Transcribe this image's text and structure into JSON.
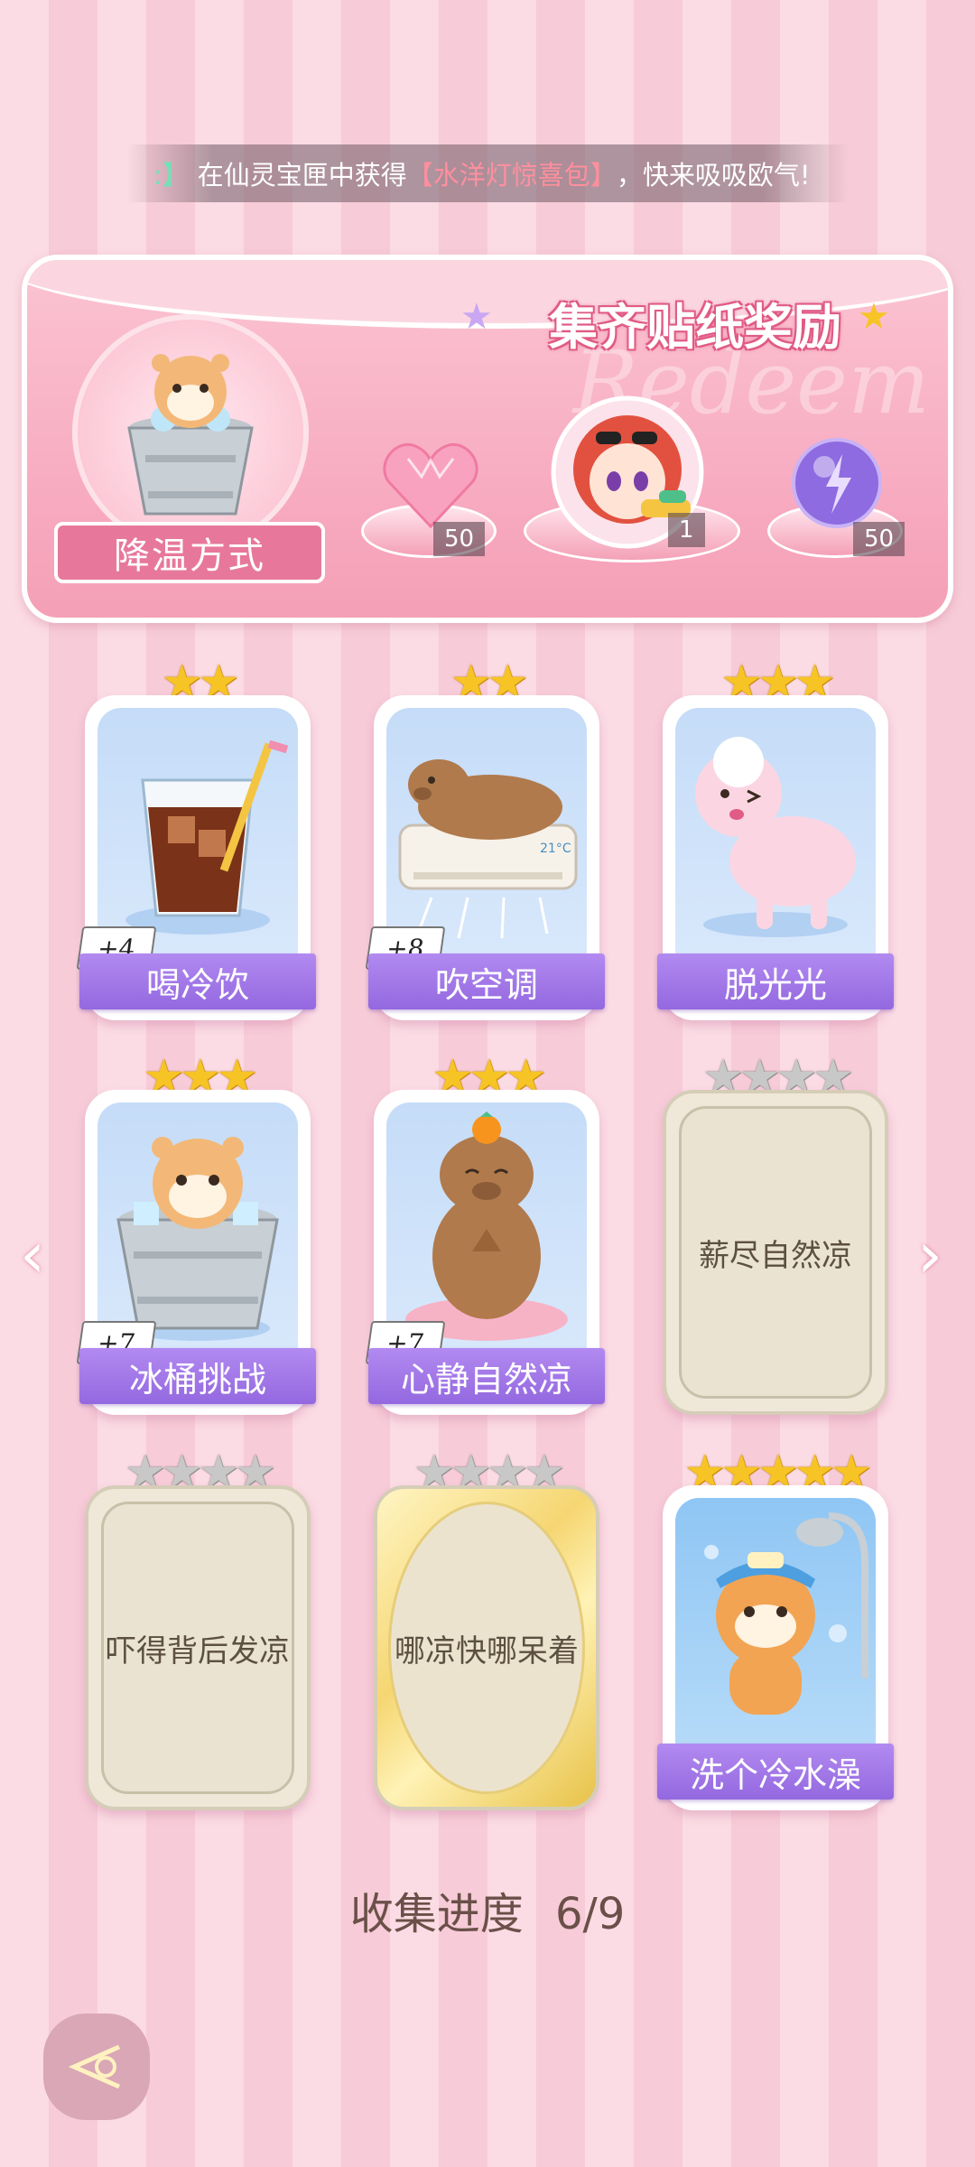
{
  "ticker": {
    "lead": ":】",
    "prefix": "在仙灵宝匣中获得",
    "highlight": "【水洋灯惊喜包】",
    "suffix": "，快来吸吸欧气!"
  },
  "banner": {
    "title": "集齐贴纸奖励",
    "watermark": "Redeem",
    "ribbon_label": "降温方式",
    "rewards": [
      {
        "icon": "pink-heart-gem-icon",
        "count": "50"
      },
      {
        "icon": "water-gun-girl-avatar",
        "count": "1"
      },
      {
        "icon": "purple-lightning-orb-icon",
        "count": "50"
      }
    ]
  },
  "cards": [
    {
      "label": "喝冷饮",
      "plus": "+4",
      "stars": 2,
      "art": "iced-drink-art",
      "locked": false
    },
    {
      "label": "吹空调",
      "plus": "+8",
      "stars": 2,
      "art": "capybara-aircon-art",
      "locked": false
    },
    {
      "label": "脱光光",
      "plus": "",
      "stars": 3,
      "art": "sheep-art",
      "locked": false
    },
    {
      "label": "冰桶挑战",
      "plus": "+7",
      "stars": 3,
      "art": "hamster-ice-bucket-art",
      "locked": false
    },
    {
      "label": "心静自然凉",
      "plus": "+7",
      "stars": 3,
      "art": "capybara-meditating-art",
      "locked": false
    },
    {
      "label": "薪尽自然凉",
      "plus": "",
      "stars": 4,
      "art": "",
      "locked": true
    },
    {
      "label": "吓得背后发凉",
      "plus": "",
      "stars": 4,
      "art": "",
      "locked": true
    },
    {
      "label": "哪凉快哪呆着",
      "plus": "",
      "stars": 4,
      "art": "",
      "locked": true
    },
    {
      "label": "洗个冷水澡",
      "plus": "",
      "stars": 5,
      "art": "cat-shower-art",
      "locked": false
    }
  ],
  "progress": {
    "label": "收集进度",
    "value": "6/9"
  }
}
